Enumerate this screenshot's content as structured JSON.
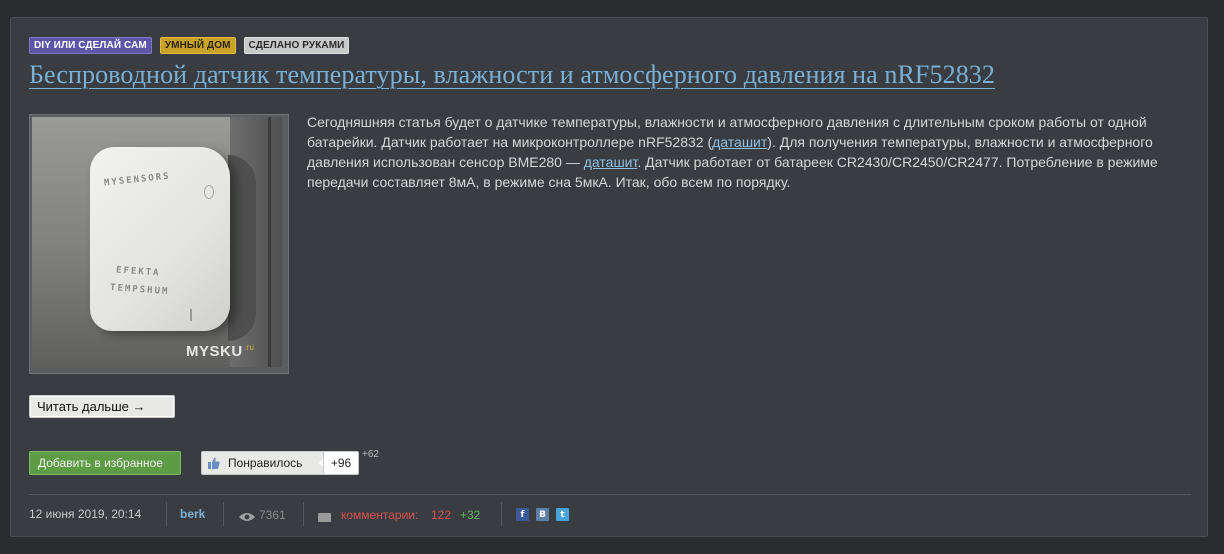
{
  "post": {
    "tags": [
      "DIY или Сделай Сам",
      "Умный дом",
      "Сделано руками"
    ],
    "title": "Беспроводной датчик температуры, влажности и атмосферного давления на nRF52832",
    "image": {
      "watermark": "MYSKU",
      "watermark_suffix": ".ru",
      "device_label_top": "MYSENSORS",
      "device_label_mid": "EFEKTA",
      "device_label_bottom": "TEMPSHUM"
    },
    "description": {
      "part1": "Сегодняшняя статья будет о датчике температуры, влажности и атмосферного давления с длительным сроком работы от одной батарейки. Датчик работает на микроконтроллере nRF52832 (",
      "link1": "даташит",
      "part2": "). Для получения температуры, влажности и атмосферного давления использован сенсор BME280 — ",
      "link2": "даташит",
      "part3": ". Датчик работает от батареек CR2430/CR2450/CR2477. Потребление в режиме передачи составляет 8мА, в режиме сна 5мкА. Итак, обо всем по порядку."
    },
    "read_more": "Читать дальше →",
    "favorite_button": "Добавить в избранное",
    "like_button": "Понравилось",
    "like_count": "+96",
    "like_extra": "+62",
    "meta": {
      "date": "12 июня 2019, 20:14",
      "author": "berk",
      "views": "7361",
      "comments_label": "комментарии:",
      "comments_count": "122",
      "comments_new": "+32"
    },
    "share": [
      "facebook-icon",
      "vk-icon",
      "twitter-icon"
    ]
  },
  "colors": {
    "background": "#2a2c30",
    "card": "#393c41",
    "link": "#7ab0d4",
    "accent_green": "#5e9b45",
    "comments_red": "#d9534f"
  }
}
